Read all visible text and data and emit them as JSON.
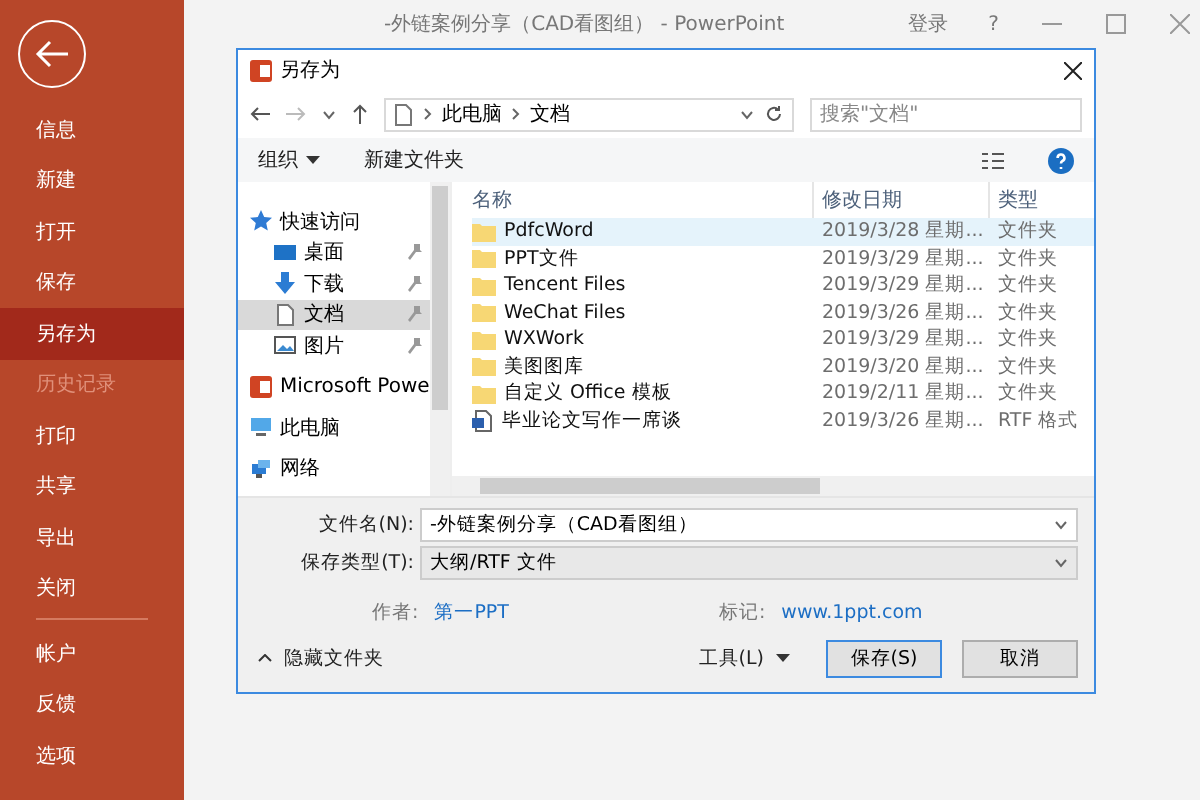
{
  "window": {
    "title": "-外链案例分享（CAD看图组） - PowerPoint",
    "signin": "登录",
    "help": "?"
  },
  "sidebar": {
    "items": [
      {
        "label": "信息",
        "selected": false,
        "disabled": false,
        "divider_after": false
      },
      {
        "label": "新建",
        "selected": false,
        "disabled": false,
        "divider_after": false
      },
      {
        "label": "打开",
        "selected": false,
        "disabled": false,
        "divider_after": false
      },
      {
        "label": "保存",
        "selected": false,
        "disabled": false,
        "divider_after": false
      },
      {
        "label": "另存为",
        "selected": true,
        "disabled": false,
        "divider_after": false
      },
      {
        "label": "历史记录",
        "selected": false,
        "disabled": true,
        "divider_after": false
      },
      {
        "label": "打印",
        "selected": false,
        "disabled": false,
        "divider_after": false
      },
      {
        "label": "共享",
        "selected": false,
        "disabled": false,
        "divider_after": false
      },
      {
        "label": "导出",
        "selected": false,
        "disabled": false,
        "divider_after": false
      },
      {
        "label": "关闭",
        "selected": false,
        "disabled": false,
        "divider_after": true
      },
      {
        "label": "帐户",
        "selected": false,
        "disabled": false,
        "divider_after": false
      },
      {
        "label": "反馈",
        "selected": false,
        "disabled": false,
        "divider_after": false
      },
      {
        "label": "选项",
        "selected": false,
        "disabled": false,
        "divider_after": false
      }
    ]
  },
  "dialog": {
    "title": "另存为",
    "breadcrumb": [
      "此电脑",
      "文档"
    ],
    "search": {
      "placeholder": "搜索\"文档\""
    },
    "toolbar": {
      "organize": "组织",
      "new_folder": "新建文件夹"
    },
    "nav": [
      {
        "label": "快速访问",
        "kind": "star",
        "selected": false,
        "pinned": false,
        "children": [
          {
            "label": "桌面",
            "kind": "desktop",
            "selected": false,
            "pinned": true
          },
          {
            "label": "下载",
            "kind": "download",
            "selected": false,
            "pinned": true
          },
          {
            "label": "文档",
            "kind": "document",
            "selected": true,
            "pinned": true
          },
          {
            "label": "图片",
            "kind": "picture",
            "selected": false,
            "pinned": true
          }
        ]
      },
      {
        "label": "Microsoft Powe",
        "kind": "app",
        "selected": false,
        "pinned": false
      },
      {
        "label": "此电脑",
        "kind": "computer",
        "selected": false,
        "pinned": false
      },
      {
        "label": "网络",
        "kind": "network",
        "selected": false,
        "pinned": false
      }
    ],
    "columns": [
      "名称",
      "修改日期",
      "类型"
    ],
    "files": [
      {
        "name": "PdfcWord",
        "date": "2019/3/28 星期...",
        "type": "文件夹",
        "kind": "folder",
        "selected": true
      },
      {
        "name": "PPT文件",
        "date": "2019/3/29 星期...",
        "type": "文件夹",
        "kind": "folder",
        "selected": false
      },
      {
        "name": "Tencent Files",
        "date": "2019/3/29 星期...",
        "type": "文件夹",
        "kind": "folder",
        "selected": false
      },
      {
        "name": "WeChat Files",
        "date": "2019/3/26 星期...",
        "type": "文件夹",
        "kind": "folder",
        "selected": false
      },
      {
        "name": "WXWork",
        "date": "2019/3/29 星期...",
        "type": "文件夹",
        "kind": "folder",
        "selected": false
      },
      {
        "name": "美图图库",
        "date": "2019/3/20 星期...",
        "type": "文件夹",
        "kind": "folder",
        "selected": false
      },
      {
        "name": "自定义 Office 模板",
        "date": "2019/2/11 星期...",
        "type": "文件夹",
        "kind": "folder",
        "selected": false
      },
      {
        "name": "毕业论文写作一席谈",
        "date": "2019/3/26 星期...",
        "type": "RTF 格式",
        "kind": "document",
        "selected": false
      }
    ],
    "filename": {
      "label": "文件名(N):",
      "value": "-外链案例分享（CAD看图组）"
    },
    "filetype": {
      "label": "保存类型(T):",
      "value": "大纲/RTF 文件"
    },
    "author": {
      "label": "作者:",
      "value": "第一PPT"
    },
    "tags": {
      "label": "标记:",
      "value": "www.1ppt.com"
    },
    "hide_folders": "隐藏文件夹",
    "tools": "工具(L)",
    "save": "保存(S)",
    "cancel": "取消"
  }
}
